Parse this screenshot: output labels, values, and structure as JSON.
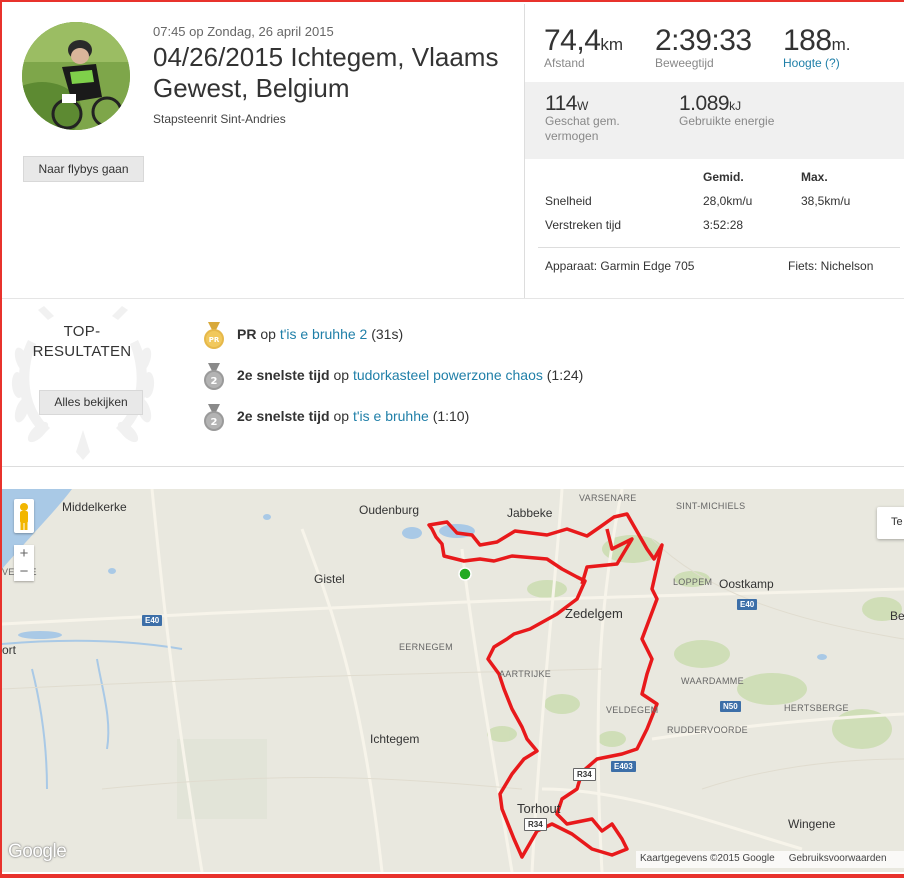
{
  "activity": {
    "date_line": "07:45 op Zondag, 26 april 2015",
    "title": "04/26/2015 Ichtegem, Vlaams Gewest, Belgium",
    "subtitle": "Stapsteenrit Sint-Andries",
    "flyby_button": "Naar flybys gaan"
  },
  "stats": {
    "distance": {
      "value": "74,4",
      "unit": "km",
      "label": "Afstand"
    },
    "moving_time": {
      "value": "2:39:33",
      "unit": "",
      "label": "Beweegtijd"
    },
    "elevation": {
      "value": "188",
      "unit": "m.",
      "label": "Hoogte (?)"
    },
    "power": {
      "value": "114",
      "unit": "W",
      "label": "Geschat gem. vermogen"
    },
    "energy": {
      "value": "1.089",
      "unit": "kJ",
      "label": "Gebruikte energie"
    }
  },
  "table": {
    "headers": [
      "",
      "Gemid.",
      "Max."
    ],
    "rows": [
      [
        "Snelheid",
        "28,0km/u",
        "38,5km/u"
      ],
      [
        "Verstreken tijd",
        "3:52:28",
        ""
      ]
    ],
    "device": "Apparaat: Garmin Edge 705",
    "bike": "Fiets: Nichelson"
  },
  "top_results": {
    "title": "TOP-RESULTATEN",
    "view_all": "Alles bekijken",
    "items": [
      {
        "medal": "PR",
        "rank_text": "PR",
        "op": "op",
        "segment": "t'is e bruhhe 2",
        "time": "(31s)"
      },
      {
        "medal": "2",
        "rank_text": "2e snelste tijd",
        "op": "op",
        "segment": "tudorkasteel powerzone chaos",
        "time": "(1:24)"
      },
      {
        "medal": "2",
        "rank_text": "2e snelste tijd",
        "op": "op",
        "segment": "t'is e bruhhe",
        "time": "(1:10)"
      }
    ]
  },
  "map": {
    "places": {
      "middelkerke": "Middelkerke",
      "oudenburg": "Oudenburg",
      "jabbeke": "Jabbeke",
      "varsenare": "VARSENARE",
      "sint_michiels": "SINT-MICHIELS",
      "gistel": "Gistel",
      "loppem": "LOPPEM",
      "oostkamp": "Oostkamp",
      "zedelgem": "Zedelgem",
      "eernegem": "EERNEGEM",
      "aartrijke": "AARTRIJKE",
      "waardamme": "WAARDAMME",
      "hertsberge": "HERTSBERGE",
      "veldegem": "VELDEGEM",
      "ruddervoorde": "RUDDERVOORDE",
      "ichtegem": "Ichtegem",
      "torhout": "Torhout",
      "wingene": "Wingene",
      "left_vesde": "VES   DE",
      "left_port": "ort",
      "right_be": "Be"
    },
    "roads": {
      "e40_west": "E40",
      "e40_east": "E40",
      "n50": "N50",
      "e403": "E403",
      "r34_a": "R34",
      "r34_b": "R34"
    },
    "zoom_in": "+",
    "zoom_out": "−",
    "map_type": "Te",
    "google": "Google",
    "attribution": "Kaartgegevens ©2015 Google",
    "terms": "Gebruiksvoorwaarden",
    "route_color": "#e8191b",
    "start_color": "#22aa22"
  }
}
